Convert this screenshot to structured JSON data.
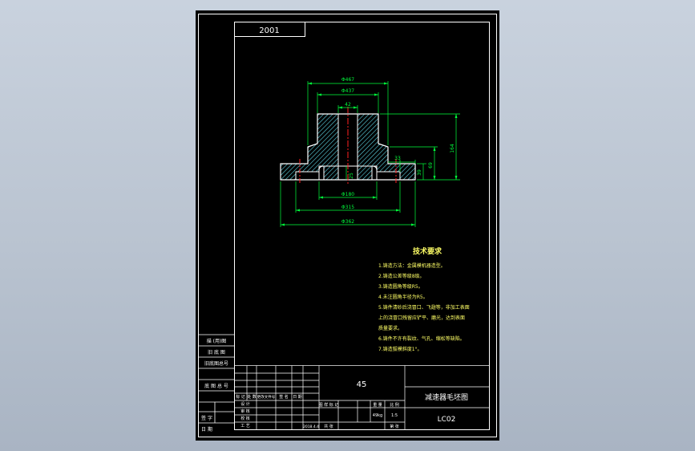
{
  "title_block": {
    "drawing_code_box": "2001",
    "material": "45",
    "part_name": "减速器毛坯图",
    "drawing_number": "LC02",
    "cells": {
      "stage_mark": "图 样 标 记",
      "weight": "重 量",
      "scale": "比 例",
      "scale_value": "1:5",
      "sheet_total": "共   张",
      "sheet_index": "第   张",
      "signature": "签 名",
      "date": "日 期",
      "marks": "标 记",
      "count": "处 数",
      "change_doc": "更改文件号",
      "designer": "设 计",
      "checker": "校 核",
      "approver": "审 核",
      "process": "工 艺",
      "weight_value": "49kg",
      "date_value": "2018.4.4"
    }
  },
  "side_panel": {
    "label_top": "描 (用)图",
    "label_second": "旧 底 图",
    "label_third": "旧底图总号",
    "label_fourth": "底 图 总 号",
    "label_fifth": "签 字",
    "label_sixth": "日 期"
  },
  "dimensions": {
    "d_top_outer": "Φ467",
    "d_top_inner": "Φ437",
    "bore": "42",
    "height_total": "164",
    "height_right": "69",
    "height_step": "39",
    "step_small": "33",
    "height_bottom": "25",
    "d_bottom_inner": "Φ180",
    "d_bottom_mid": "Φ315",
    "d_bottom_outer": "Φ362"
  },
  "technical_requirements": {
    "heading": "技术要求",
    "items": [
      "1.铸造方法：金属模机器造型。",
      "2.铸造公差等级8级。",
      "3.铸造圆角等级R5。",
      "4.未注圆角半径为R5。",
      "5.铸件清砂后浇冒口、飞翅等，非加工表面",
      "上的浇冒口残留应铲平、磨光，达到表面",
      "质量要求。",
      "6.铸件不许有裂纹、气孔、缩松等缺陷。",
      "7.铸造拔模斜度1°。"
    ]
  },
  "colors": {
    "line_white": "#ffffff",
    "dim_green": "#00ff3c",
    "hatch_cyan": "#5fd7e6",
    "center_red": "#ff2020",
    "text_yellow": "#ffff66"
  }
}
